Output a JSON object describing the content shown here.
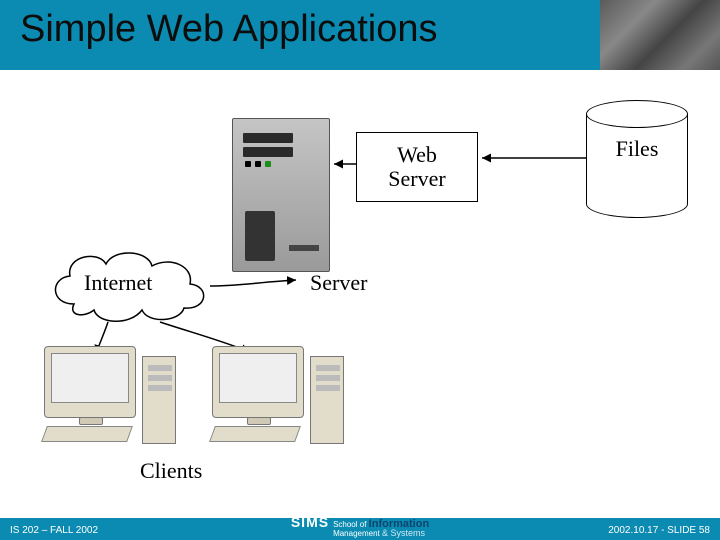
{
  "title": "Simple Web Applications",
  "labels": {
    "web_server": "Web\nServer",
    "files": "Files",
    "internet": "Internet",
    "server": "Server",
    "clients": "Clients"
  },
  "footer": {
    "left": "IS 202 – FALL 2002",
    "right": "2002.10.17 - SLIDE 58",
    "logo_main": "SIMS",
    "logo_line1": "School of",
    "logo_info": "Information",
    "logo_line2_a": "Management",
    "logo_line2_b": "& Systems"
  }
}
